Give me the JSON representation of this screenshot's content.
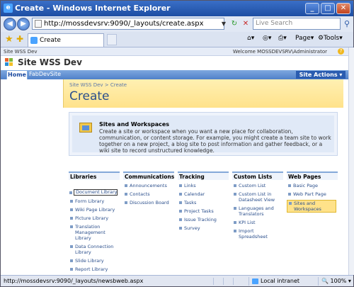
{
  "window": {
    "title": "Create - Windows Internet Explorer"
  },
  "addressbar": {
    "url": "http://mossdevsrv:9090/_layouts/create.aspx",
    "search_placeholder": "Live Search"
  },
  "tabs": [
    {
      "label": "Create"
    }
  ],
  "commandbar": {
    "page": "Page",
    "tools": "Tools"
  },
  "sharepoint": {
    "site_link": "Site WSS Dev",
    "welcome": "Welcome MOSSDEVSRV\\Administrator",
    "site_title": "Site WSS Dev",
    "nav": {
      "home": "Home",
      "other": "FabDevSite"
    },
    "site_actions": "Site Actions",
    "breadcrumb": "Site WSS Dev > Create",
    "page_title": "Create",
    "desc_title": "Sites and Workspaces",
    "desc_text": "Create a site or workspace when you want a new place for collaboration, communication, or content storage. For example, you might create a team site to work together on a new project, a blog site to post information and gather feedback, or a wiki site to record unstructured knowledge."
  },
  "columns": [
    {
      "header": "Libraries",
      "items": [
        "Document Library",
        "Form Library",
        "Wiki Page Library",
        "Picture Library",
        "Translation Management Library",
        "Data Connection Library",
        "Slide Library",
        "Report Library"
      ]
    },
    {
      "header": "Communications",
      "items": [
        "Announcements",
        "Contacts",
        "Discussion Board"
      ]
    },
    {
      "header": "Tracking",
      "items": [
        "Links",
        "Calendar",
        "Tasks",
        "Project Tasks",
        "Issue Tracking",
        "Survey"
      ]
    },
    {
      "header": "Custom Lists",
      "items": [
        "Custom List",
        "Custom List in Datasheet View",
        "Languages and Translators",
        "KPI List",
        "Import Spreadsheet"
      ]
    },
    {
      "header": "Web Pages",
      "items": [
        "Basic Page",
        "Web Part Page",
        "Sites and Workspaces"
      ]
    }
  ],
  "statusbar": {
    "url": "http://mossdevsrv:9090/_layouts/newsbweb.aspx",
    "zone": "Local intranet",
    "zoom": "100%"
  }
}
